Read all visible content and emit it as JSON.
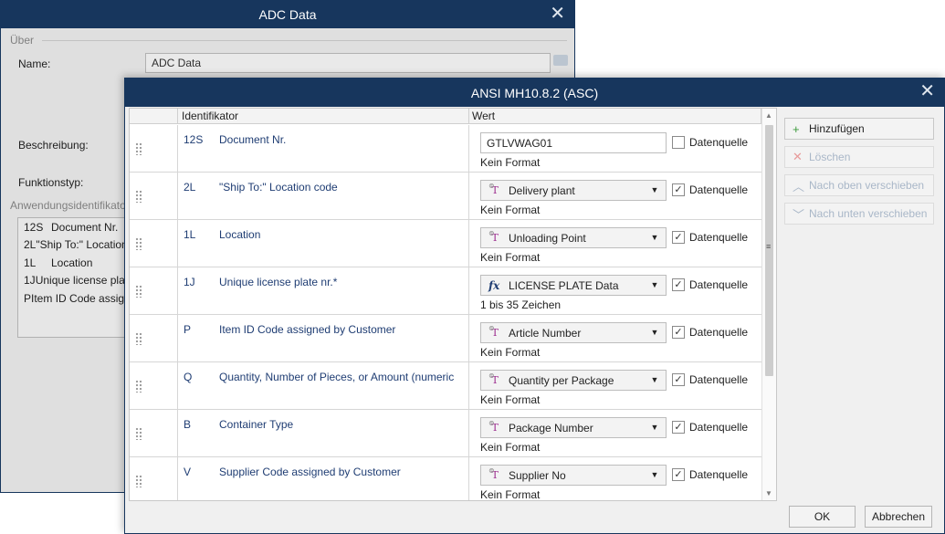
{
  "back_dialog": {
    "title": "ADC Data",
    "section_about": "Über",
    "name_label": "Name:",
    "name_value": "ADC Data",
    "description_label": "Beschreibung:",
    "function_type_label": "Funktionstyp:",
    "ai_section_label": "Anwendungsidentifikatoren",
    "ai_list": [
      {
        "code": "12S",
        "label": "Document Nr."
      },
      {
        "code": "2L",
        "label": "\"Ship To:\" Location code"
      },
      {
        "code": "1L",
        "label": "Location"
      },
      {
        "code": "1J",
        "label": "Unique license plate nr.*"
      },
      {
        "code": "P",
        "label": "Item ID Code assigned by Customer"
      }
    ]
  },
  "front_dialog": {
    "title": "ANSI MH10.8.2 (ASC)",
    "col_identifier": "Identifikator",
    "col_value": "Wert",
    "checkbox_label": "Datenquelle",
    "rows": [
      {
        "code": "12S",
        "desc": "Document Nr.",
        "type": "text",
        "value": "GTLVWAG01",
        "checked": false,
        "format": "Kein Format"
      },
      {
        "code": "2L",
        "desc": "\"Ship To:\" Location code",
        "type": "variable",
        "value": "Delivery plant",
        "checked": true,
        "format": "Kein Format"
      },
      {
        "code": "1L",
        "desc": "Location",
        "type": "variable",
        "value": "Unloading Point",
        "checked": true,
        "format": "Kein Format"
      },
      {
        "code": "1J",
        "desc": "Unique license plate nr.*",
        "type": "function",
        "value": "LICENSE PLATE Data",
        "checked": true,
        "format": "1 bis 35 Zeichen"
      },
      {
        "code": "P",
        "desc": "Item ID Code assigned by Customer",
        "type": "variable",
        "value": "Article Number",
        "checked": true,
        "format": "Kein Format"
      },
      {
        "code": "Q",
        "desc": "Quantity, Number of Pieces, or Amount (numeric",
        "type": "variable",
        "value": "Quantity per Package",
        "checked": true,
        "format": "Kein Format"
      },
      {
        "code": "B",
        "desc": "Container Type",
        "type": "variable",
        "value": "Package Number",
        "checked": true,
        "format": "Kein Format"
      },
      {
        "code": "V",
        "desc": "Supplier Code assigned by Customer",
        "type": "variable",
        "value": "Supplier No",
        "checked": true,
        "format": "Kein Format"
      }
    ],
    "buttons": {
      "add": "Hinzufügen",
      "delete": "Löschen",
      "move_up": "Nach oben verschieben",
      "move_down": "Nach unten verschieben",
      "ok": "OK",
      "cancel": "Abbrechen"
    }
  },
  "colors": {
    "titlebar": "#17365d",
    "identifier_text": "#1f3d73",
    "add_icon": "#3a9a3a",
    "delete_icon": "#e06060",
    "variable_icon": "#9c2c8f"
  }
}
